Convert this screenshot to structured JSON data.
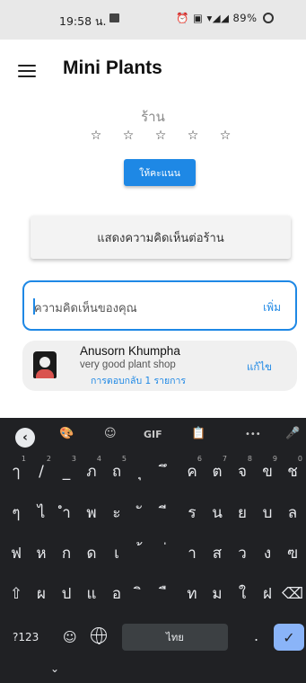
{
  "status_bar": {
    "time": "19:58 น.",
    "battery": "89%",
    "signal_icons": "⏰ ▣ ▾◢◢"
  },
  "app_bar": {
    "title": "Mini Plants"
  },
  "shop": {
    "label": "ร้าน",
    "stars": [
      "☆",
      "☆",
      "☆",
      "☆",
      "☆"
    ],
    "rate_button": "ให้คะแนน"
  },
  "show_comments_button": "แสดงความคิดเห็นต่อร้าน",
  "comment_input": {
    "placeholder": "ความคิดเห็นของคุณ",
    "add_label": "เพิ่ม"
  },
  "comment": {
    "author": "Anusorn Khumpha",
    "text": "very good plant shop",
    "replies": "การตอบกลับ 1 รายการ",
    "edit_label": "แก้ไข"
  },
  "keyboard": {
    "toolbar": [
      "🎨",
      "☺",
      "GIF",
      "📋",
      "•••",
      "🎤"
    ],
    "rows": [
      [
        [
          "ๅ",
          "1"
        ],
        [
          "/",
          "2"
        ],
        [
          "_",
          "3"
        ],
        [
          "ภ",
          "4"
        ],
        [
          "ถ",
          "5"
        ],
        [
          "ุ",
          ""
        ],
        [
          "ึ",
          ""
        ],
        [
          "ค",
          "6"
        ],
        [
          "ต",
          "7"
        ],
        [
          "จ",
          "8"
        ],
        [
          "ข",
          "9"
        ],
        [
          "ช",
          "0"
        ]
      ],
      [
        [
          "ๆ",
          ""
        ],
        [
          "ไ",
          ""
        ],
        [
          "ำ",
          ""
        ],
        [
          "พ",
          ""
        ],
        [
          "ะ",
          ""
        ],
        [
          "ั",
          ""
        ],
        [
          "ี",
          ""
        ],
        [
          "ร",
          ""
        ],
        [
          "น",
          ""
        ],
        [
          "ย",
          ""
        ],
        [
          "บ",
          ""
        ],
        [
          "ล",
          ""
        ]
      ],
      [
        [
          "ฟ",
          ""
        ],
        [
          "ห",
          ""
        ],
        [
          "ก",
          ""
        ],
        [
          "ด",
          ""
        ],
        [
          "เ",
          ""
        ],
        [
          "้",
          ""
        ],
        [
          "่",
          ""
        ],
        [
          "า",
          ""
        ],
        [
          "ส",
          ""
        ],
        [
          "ว",
          ""
        ],
        [
          "ง",
          ""
        ],
        [
          "ฃ",
          ""
        ]
      ],
      [
        [
          "⇧",
          ""
        ],
        [
          "ผ",
          ""
        ],
        [
          "ป",
          ""
        ],
        [
          "แ",
          ""
        ],
        [
          "อ",
          ""
        ],
        [
          "ิ",
          ""
        ],
        [
          "ื",
          ""
        ],
        [
          "ท",
          ""
        ],
        [
          "ม",
          ""
        ],
        [
          "ใ",
          ""
        ],
        [
          "ฝ",
          ""
        ],
        [
          "⌫",
          ""
        ]
      ]
    ],
    "sym_label": "?123",
    "emoji_label": "☺",
    "space_label": "ไทย",
    "dot_label": ".",
    "enter_label": "✓",
    "hide_label": "⌄"
  }
}
